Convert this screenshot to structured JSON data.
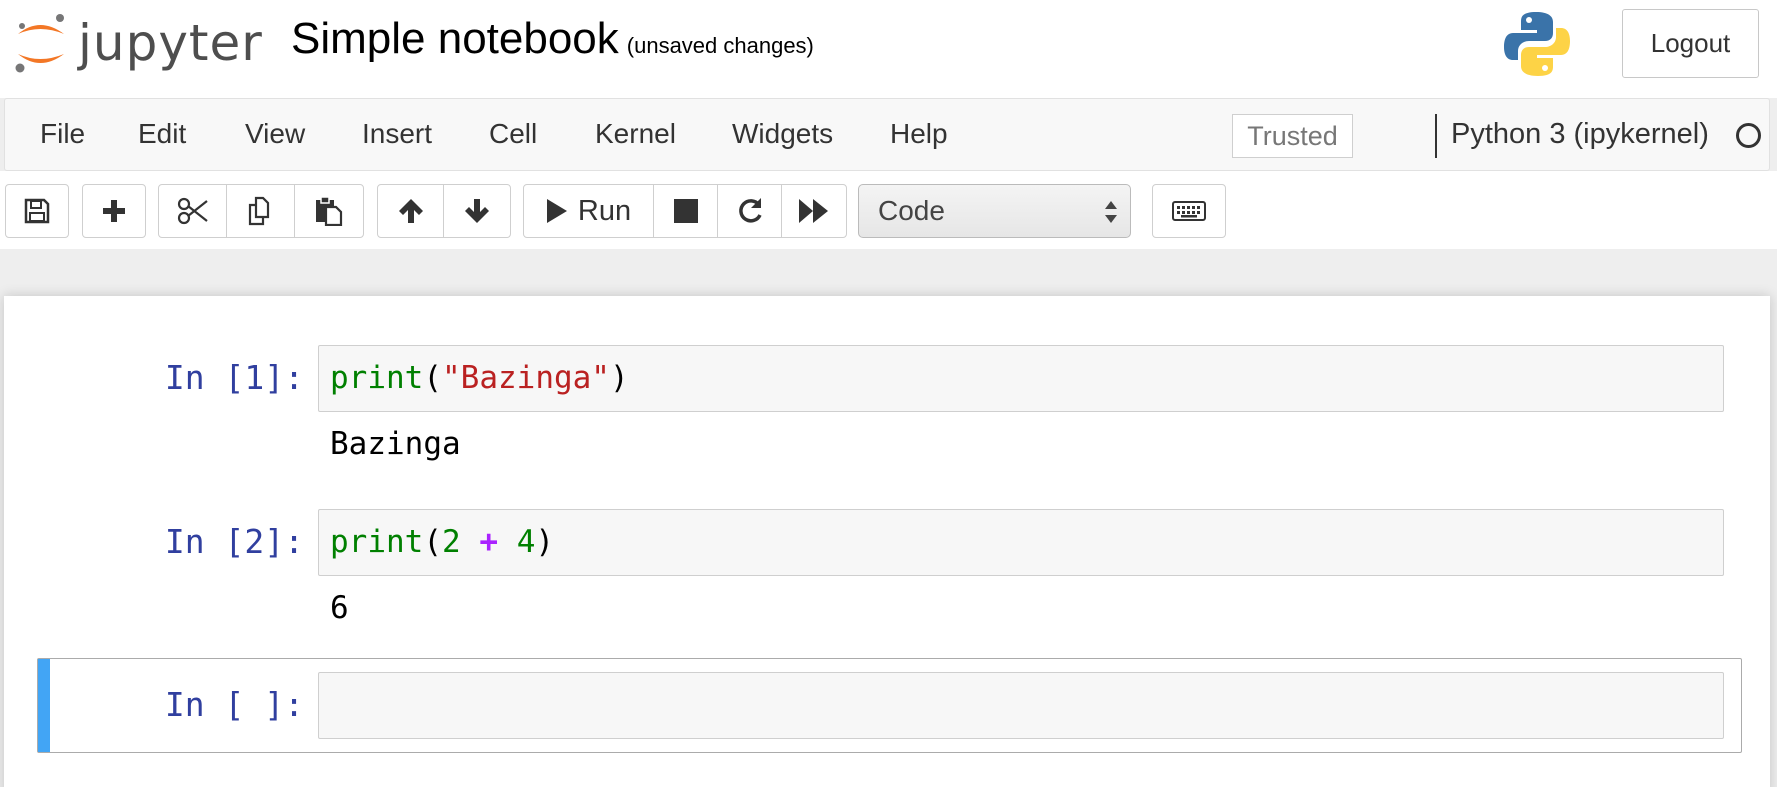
{
  "header": {
    "logo_text": "jupyter",
    "notebook_title": "Simple notebook",
    "save_status": "(unsaved changes)",
    "logout_label": "Logout"
  },
  "menubar": {
    "items": [
      "File",
      "Edit",
      "View",
      "Insert",
      "Cell",
      "Kernel",
      "Widgets",
      "Help"
    ],
    "trusted_label": "Trusted",
    "kernel_name": "Python 3 (ipykernel)"
  },
  "toolbar": {
    "run_label": "Run",
    "cell_type": "Code",
    "icons": [
      "save-icon",
      "plus-icon",
      "cut-icon",
      "copy-icon",
      "paste-icon",
      "arrow-up-icon",
      "arrow-down-icon",
      "play-icon",
      "stop-icon",
      "restart-icon",
      "fast-forward-icon",
      "keyboard-icon"
    ]
  },
  "cells": [
    {
      "prompt": "In [1]:",
      "tokens": [
        {
          "text": "print",
          "kind": "builtin"
        },
        {
          "text": "(",
          "kind": "punct"
        },
        {
          "text": "\"Bazinga\"",
          "kind": "string"
        },
        {
          "text": ")",
          "kind": "punct"
        }
      ],
      "output": "Bazinga"
    },
    {
      "prompt": "In [2]:",
      "tokens": [
        {
          "text": "print",
          "kind": "builtin"
        },
        {
          "text": "(",
          "kind": "punct"
        },
        {
          "text": "2",
          "kind": "number"
        },
        {
          "text": " ",
          "kind": "punct"
        },
        {
          "text": "+",
          "kind": "op"
        },
        {
          "text": " ",
          "kind": "punct"
        },
        {
          "text": "4",
          "kind": "number"
        },
        {
          "text": ")",
          "kind": "punct"
        }
      ],
      "output": "6"
    },
    {
      "prompt": "In [ ]:",
      "tokens": [],
      "output": ""
    }
  ],
  "colors": {
    "prompt": "#303f9f",
    "selected_cell_bar": "#42a5f5",
    "jupyter_orange": "#f37726"
  }
}
